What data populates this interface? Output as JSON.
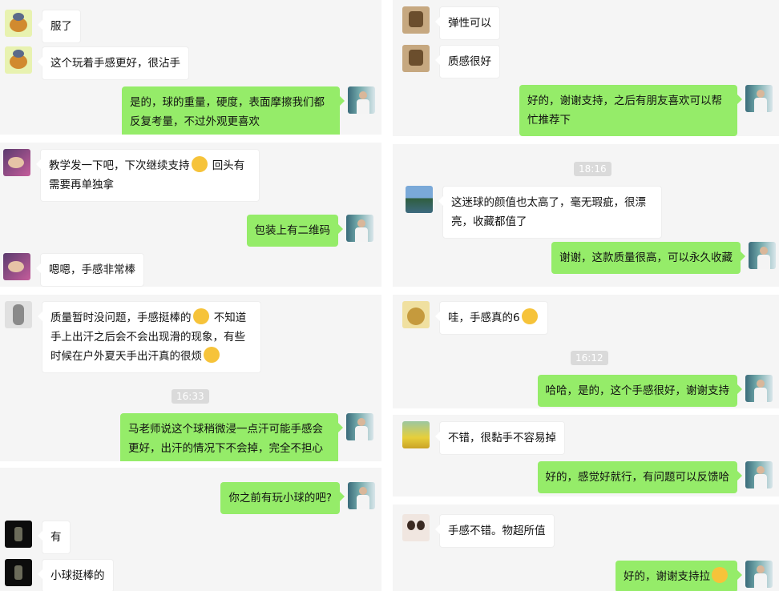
{
  "left_column": {
    "panel1": {
      "messages": [
        {
          "text": "服了"
        },
        {
          "text": "这个玩着手感更好，很沾手"
        },
        {
          "text": "是的，球的重量，硬度，表面摩擦我们都反复考量，不过外观更喜欢"
        }
      ]
    },
    "panel2": {
      "messages": [
        {
          "text_before": "教学发一下吧，下次继续支持",
          "emoji": "raised-hand-emoji",
          "text_after": " 回头有需要再单独拿"
        },
        {
          "text": "包装上有二维码"
        },
        {
          "text": "嗯嗯，手感非常棒"
        }
      ]
    },
    "panel3": {
      "messages": [
        {
          "text_before": "质量暂时没问题，手感挺棒的",
          "emoji1": "thumbs-up-emoji",
          "text_middle": " 不知道手上出汗之后会不会出现滑的现象，有些时候在户外夏天手出汗真的很烦",
          "emoji2": "weary-face-emoji"
        }
      ],
      "time": "16:33",
      "reply": "马老师说这个球稍微浸一点汗可能手感会更好，出汗的情况下不会掉，完全不担心"
    },
    "panel4": {
      "messages": [
        {
          "text": "你之前有玩小球的吧?"
        },
        {
          "text": "有"
        },
        {
          "text": "小球挺棒的"
        }
      ]
    }
  },
  "right_column": {
    "panel1": {
      "messages": [
        {
          "text": "弹性可以"
        },
        {
          "text": "质感很好"
        },
        {
          "text": "好的，谢谢支持，之后有朋友喜欢可以帮忙推荐下"
        }
      ]
    },
    "panel2": {
      "time": "18:16",
      "messages": [
        {
          "text": "这迷球的颜值也太高了，毫无瑕疵，很漂亮，收藏都值了"
        },
        {
          "text": "谢谢，这款质量很高，可以永久收藏"
        }
      ]
    },
    "panel3": {
      "messages": [
        {
          "text_before": "哇，手感真的6",
          "emoji": "666-face-emoji"
        }
      ],
      "time": "16:12",
      "reply": "哈哈，是的，这个手感很好，谢谢支持"
    },
    "panel4": {
      "messages": [
        {
          "text": "不错，很黏手不容易掉"
        },
        {
          "text": "好的，感觉好就行，有问题可以反馈哈"
        }
      ]
    },
    "panel5": {
      "messages": [
        {
          "text": "手感不错。物超所值"
        },
        {
          "text_before": "好的，谢谢支持拉",
          "emoji": "clapping-hands-emoji"
        }
      ]
    }
  },
  "colors": {
    "panel_bg": "#f5f5f5",
    "bubble_self": "#95ec69",
    "bubble_other": "#ffffff",
    "time_badge": "#dadada"
  }
}
